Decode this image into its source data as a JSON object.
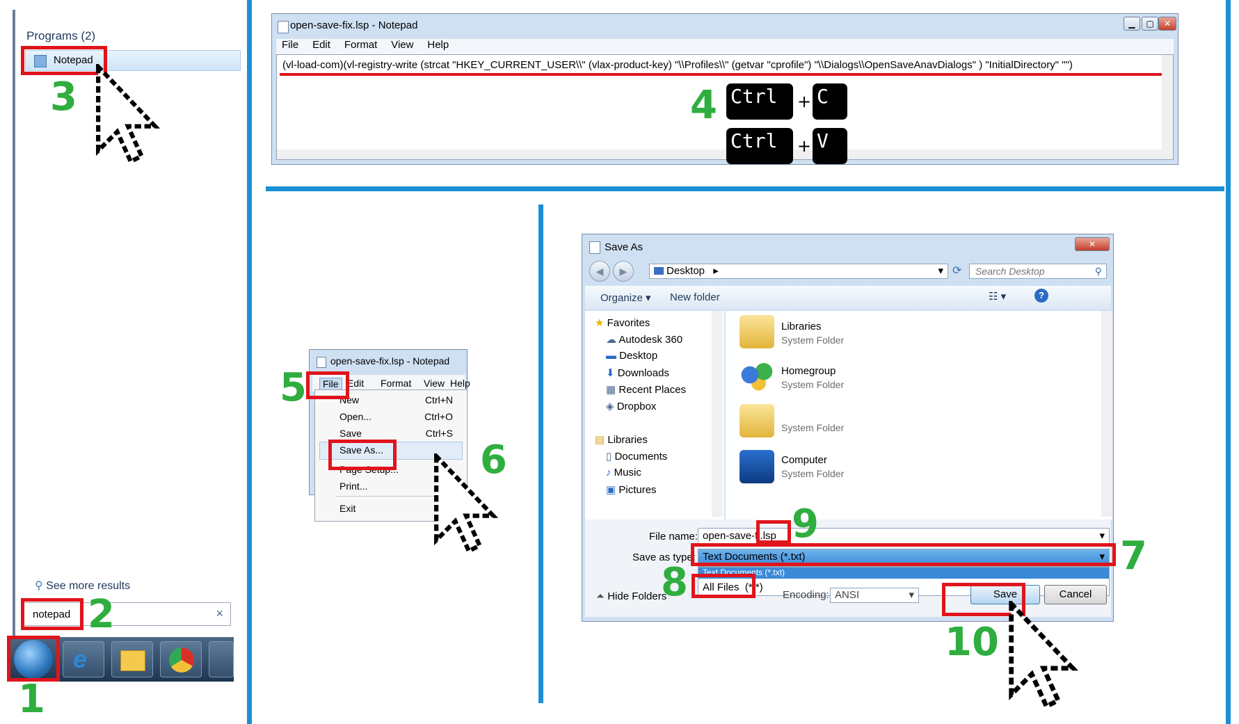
{
  "start_menu": {
    "programs_header": "Programs (2)",
    "notepad_result": "Notepad",
    "see_more": "See more results",
    "search_value": "notepad"
  },
  "notepad_window": {
    "title": "open-save-fix.lsp - Notepad",
    "menu": [
      "File",
      "Edit",
      "Format",
      "View",
      "Help"
    ],
    "code_line": "(vl-load-com)(vl-registry-write (strcat \"HKEY_CURRENT_USER\\\\\" (vlax-product-key) \"\\\\Profiles\\\\\" (getvar \"cprofile\") \"\\\\Dialogs\\\\OpenSaveAnavDialogs\" ) \"InitialDirectory\" \"\")"
  },
  "keys": {
    "ctrl": "Ctrl",
    "plus": "+",
    "copy_key": "C",
    "paste_key": "V"
  },
  "file_menu_window": {
    "title": "open-save-fix.lsp - Notepad",
    "menu": [
      "File",
      "Edit",
      "Format",
      "View",
      "Help"
    ],
    "items": [
      {
        "label": "New",
        "shortcut": "Ctrl+N"
      },
      {
        "label": "Open...",
        "shortcut": "Ctrl+O"
      },
      {
        "label": "Save",
        "shortcut": "Ctrl+S"
      },
      {
        "label": "Save As...",
        "shortcut": ""
      },
      {
        "label": "Page Setup...",
        "shortcut": ""
      },
      {
        "label": "Print...",
        "shortcut": ""
      },
      {
        "label": "Exit",
        "shortcut": ""
      }
    ]
  },
  "save_dialog": {
    "title": "Save As",
    "location": "Desktop",
    "search_placeholder": "Search Desktop",
    "organize": "Organize",
    "new_folder": "New folder",
    "nav": [
      "Favorites",
      "Autodesk 360",
      "Desktop",
      "Downloads",
      "Recent Places",
      "Dropbox",
      "Libraries",
      "Documents",
      "Music",
      "Pictures"
    ],
    "files": [
      {
        "name": "Libraries",
        "type": "System Folder"
      },
      {
        "name": "Homegroup",
        "type": "System Folder"
      },
      {
        "name": "",
        "type": "System Folder"
      },
      {
        "name": "Computer",
        "type": "System Folder"
      }
    ],
    "file_name_label": "File name:",
    "file_name_value": "open-save-fi",
    "file_name_ext": ".lsp",
    "save_type_label": "Save as type:",
    "save_type_value": "Text Documents (*.txt)",
    "dropdown_option_1": "Text Documents (*.txt)",
    "dropdown_option_2": "All Files  (*.*)",
    "encoding_label": "Encoding:",
    "encoding_value": "ANSI",
    "hide_folders": "Hide Folders",
    "save": "Save",
    "cancel": "Cancel"
  },
  "steps": [
    "1",
    "2",
    "3",
    "4",
    "5",
    "6",
    "7",
    "8",
    "9",
    "10"
  ],
  "colors": {
    "divider": "#1b8fd4",
    "step_number": "#2fae3f",
    "highlight_box": "#e0141c"
  }
}
